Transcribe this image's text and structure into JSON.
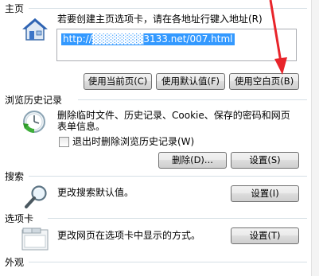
{
  "home": {
    "section_title": "主页",
    "description": "若要创建主页选项卡，请在各地址行键入地址(R)",
    "url_value": "http://▓▓▓▓▓▓▓3133.net/007.html",
    "use_current": "使用当前页(C)",
    "use_default": "使用默认值(F)",
    "use_blank": "使用空白页(B)"
  },
  "history": {
    "section_title": "浏览历史记录",
    "description": "删除临时文件、历史记录、Cookie、保存的密码和网页表单信息。",
    "checkbox_label": "退出时删除浏览历史记录(W)",
    "delete_button": "删除(D)...",
    "settings_button": "设置(S)"
  },
  "search": {
    "section_title": "搜索",
    "description": "更改搜索默认值。",
    "settings_button": "设置(I)"
  },
  "tabs": {
    "section_title": "选项卡",
    "description": "更改网页在选项卡中显示的方式。",
    "settings_button": "设置(T)"
  },
  "appearance": {
    "section_title": "外观"
  },
  "colors": {
    "annotation_arrow": "#e8242a",
    "selection": "#3399ff"
  }
}
